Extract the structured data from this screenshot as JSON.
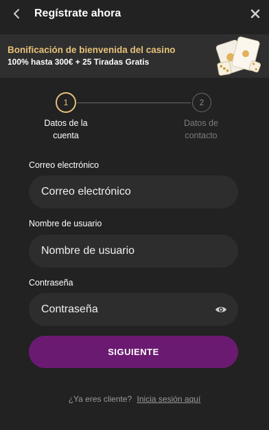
{
  "header": {
    "title": "Regístrate ahora",
    "back_icon": "chevron-left-icon",
    "close_icon": "close-icon"
  },
  "banner": {
    "title": "Bonificación de bienvenida del casino",
    "subtitle": "100% hasta 300€ + 25 Tiradas Gratis",
    "art_icon": "cards-dice-icon"
  },
  "stepper": {
    "steps": [
      {
        "number": "1",
        "label_line1": "Datos de la",
        "label_line2": "cuenta",
        "active": true
      },
      {
        "number": "2",
        "label_line1": "Datos de",
        "label_line2": "contacto",
        "active": false
      }
    ]
  },
  "form": {
    "email": {
      "label": "Correo electrónico",
      "placeholder": "Correo electrónico",
      "value": ""
    },
    "username": {
      "label": "Nombre de usuario",
      "placeholder": "Nombre de usuario",
      "value": ""
    },
    "password": {
      "label": "Contraseña",
      "placeholder": "Contraseña",
      "value": "",
      "toggle_icon": "eye-icon"
    },
    "submit_label": "SIGUIENTE"
  },
  "footer": {
    "prompt": "¿Ya eres cliente?",
    "login_link": "Inicia sesión aquí"
  },
  "colors": {
    "background": "#222222",
    "accent_gold": "#e8c27a",
    "button_purple": "#6b1a72",
    "input_bg": "#2d2d2d"
  }
}
